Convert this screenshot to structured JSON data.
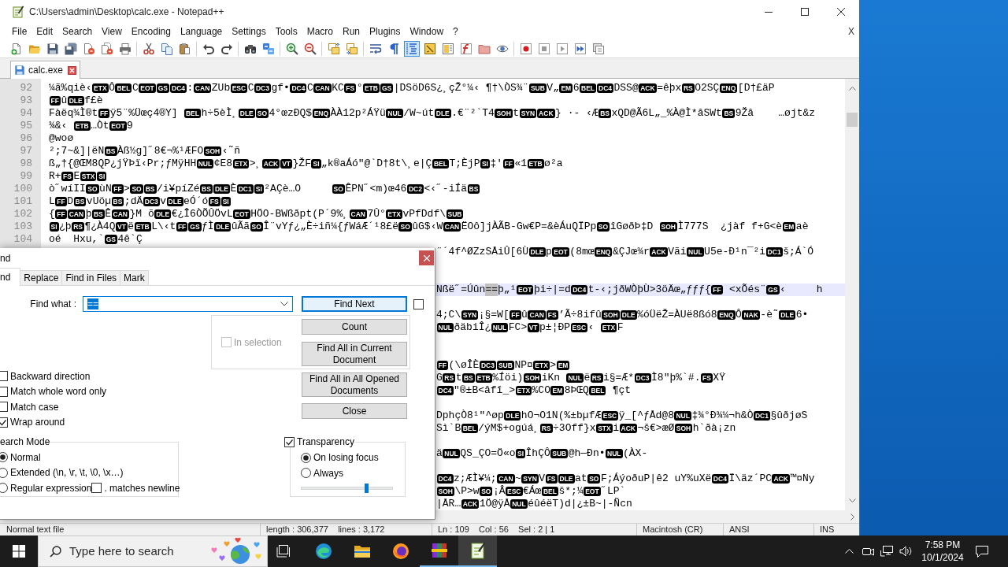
{
  "window": {
    "title": "C:\\Users\\admin\\Desktop\\calc.exe - Notepad++"
  },
  "menu": {
    "items": [
      "File",
      "Edit",
      "Search",
      "View",
      "Encoding",
      "Language",
      "Settings",
      "Tools",
      "Macro",
      "Run",
      "Plugins",
      "Window",
      "?"
    ],
    "close_document": "X"
  },
  "toolbar": [
    [
      {
        "pressed": false
      },
      {
        "pressed": false
      },
      {
        "pressed": false
      },
      {
        "pressed": false
      },
      {
        "pressed": false
      },
      {
        "pressed": false
      },
      {
        "pressed": false
      }
    ],
    [
      {
        "pressed": false
      },
      {
        "pressed": false
      },
      {
        "pressed": false
      }
    ],
    [
      {
        "pressed": false
      },
      {
        "pressed": false
      }
    ],
    [
      {
        "pressed": false
      },
      {
        "pressed": false
      }
    ],
    [
      {
        "pressed": false
      },
      {
        "pressed": false
      }
    ],
    [
      {
        "pressed": false
      },
      {
        "pressed": false
      }
    ],
    [
      {
        "pressed": false
      },
      {
        "pressed": false
      },
      {
        "pressed": true
      },
      {
        "pressed": false
      },
      {
        "pressed": false
      },
      {
        "pressed": false
      },
      {
        "pressed": false
      },
      {
        "pressed": false
      }
    ],
    [
      {
        "pressed": false
      },
      {
        "pressed": false
      },
      {
        "pressed": false
      },
      {
        "pressed": false
      },
      {
        "pressed": false
      }
    ]
  ],
  "tabs": [
    {
      "label": "calc.exe",
      "selected": true
    }
  ],
  "editor": {
    "lines": [
      {
        "number": "92",
        "current": false,
        "parts": [
          {
            "kind": "text",
            "text": "¼ã%qiè‹"
          },
          {
            "kind": "control",
            "text": "ETX"
          },
          {
            "kind": "text",
            "text": "Ô"
          },
          {
            "kind": "control",
            "text": "BEL"
          },
          {
            "kind": "text",
            "text": "C"
          },
          {
            "kind": "control",
            "text": "EOT"
          },
          {
            "kind": "control",
            "text": "GS"
          },
          {
            "kind": "control",
            "text": "DC4"
          },
          {
            "kind": "text",
            "text": ":"
          },
          {
            "kind": "control",
            "text": "CAN"
          },
          {
            "kind": "text",
            "text": "ZUb"
          },
          {
            "kind": "control",
            "text": "ESC"
          },
          {
            "kind": "text",
            "text": "C"
          },
          {
            "kind": "control",
            "text": "DC3"
          },
          {
            "kind": "text",
            "text": "gf•"
          },
          {
            "kind": "control",
            "text": "DC4"
          },
          {
            "kind": "text",
            "text": "C"
          },
          {
            "kind": "control",
            "text": "CAN"
          },
          {
            "kind": "text",
            "text": "KC"
          },
          {
            "kind": "control",
            "text": "FS"
          },
          {
            "kind": "text",
            "text": "°"
          },
          {
            "kind": "control",
            "text": "ETB"
          },
          {
            "kind": "control",
            "text": "GS"
          },
          {
            "kind": "text",
            "text": "|DSöD6S¿¸çŽ°¼‹ ¶†\\ÒS¾¨"
          },
          {
            "kind": "control",
            "text": "SUB"
          },
          {
            "kind": "text",
            "text": "V„"
          },
          {
            "kind": "control",
            "text": "EM"
          },
          {
            "kind": "text",
            "text": "6"
          },
          {
            "kind": "control",
            "text": "BEL"
          },
          {
            "kind": "control",
            "text": "DC4"
          },
          {
            "kind": "text",
            "text": "DSS@"
          },
          {
            "kind": "control",
            "text": "ACK"
          },
          {
            "kind": "text",
            "text": "=êþx"
          },
          {
            "kind": "control",
            "text": "RS"
          },
          {
            "kind": "text",
            "text": "O2SÇ"
          },
          {
            "kind": "control",
            "text": "ENQ"
          },
          {
            "kind": "text",
            "text": "[D†£äP"
          }
        ]
      },
      {
        "number": "93",
        "current": false,
        "parts": [
          {
            "kind": "control",
            "text": "FF"
          },
          {
            "kind": "text",
            "text": "û"
          },
          {
            "kind": "control",
            "text": "DLE"
          },
          {
            "kind": "text",
            "text": "f£è"
          }
        ]
      },
      {
        "number": "94",
        "current": false,
        "parts": [
          {
            "kind": "text",
            "text": "Fàëq¾Ì®t"
          },
          {
            "kind": "control",
            "text": "FF"
          },
          {
            "kind": "text",
            "text": "ÿ5¨%Üœç4®Y] "
          },
          {
            "kind": "control",
            "text": "BEL"
          },
          {
            "kind": "text",
            "text": "h÷5èÌ¸"
          },
          {
            "kind": "control",
            "text": "DLE"
          },
          {
            "kind": "control",
            "text": "SO"
          },
          {
            "kind": "text",
            "text": "4°œzÐQ$"
          },
          {
            "kind": "control",
            "text": "ENQ"
          },
          {
            "kind": "text",
            "text": "ÀÀ12p²ÁŸü"
          },
          {
            "kind": "control",
            "text": "NUL"
          },
          {
            "kind": "text",
            "text": "/W~út"
          },
          {
            "kind": "control",
            "text": "DLE"
          },
          {
            "kind": "text",
            "text": ".€¨²`T4"
          },
          {
            "kind": "control",
            "text": "SOH"
          },
          {
            "kind": "text",
            "text": "t"
          },
          {
            "kind": "control",
            "text": "SYN"
          },
          {
            "kind": "control",
            "text": "ACK"
          },
          {
            "kind": "text",
            "text": "} ·- ‹Æ"
          },
          {
            "kind": "control",
            "text": "BS"
          },
          {
            "kind": "text",
            "text": "xQD@Ã6L„_%À@Ì*âSWt"
          },
          {
            "kind": "control",
            "text": "BS"
          },
          {
            "kind": "text",
            "text": "9Žâ    …øjt&z"
          }
        ]
      },
      {
        "number": "95",
        "current": false,
        "parts": [
          {
            "kind": "text",
            "text": "¾&‹ "
          },
          {
            "kind": "control",
            "text": "ETB"
          },
          {
            "kind": "text",
            "text": "…Òt"
          },
          {
            "kind": "control",
            "text": "EOT"
          },
          {
            "kind": "text",
            "text": "9"
          }
        ]
      },
      {
        "number": "96",
        "current": false,
        "parts": [
          {
            "kind": "text",
            "text": "@woø"
          }
        ]
      },
      {
        "number": "97",
        "current": false,
        "parts": [
          {
            "kind": "text",
            "text": "²;7~&]|ëN"
          },
          {
            "kind": "control",
            "text": "BS"
          },
          {
            "kind": "text",
            "text": "Àß½g]˝8€¬%¹ÆFO"
          },
          {
            "kind": "control",
            "text": "SOH"
          },
          {
            "kind": "text",
            "text": "‹˜ñ"
          }
        ]
      },
      {
        "number": "98",
        "current": false,
        "parts": [
          {
            "kind": "text",
            "text": "ß„†{@ŒM8QP¿jŸÞï‹Pr;ƒMÿHH"
          },
          {
            "kind": "control",
            "text": "NUL"
          },
          {
            "kind": "text",
            "text": "¢E8"
          },
          {
            "kind": "control",
            "text": "ETX"
          },
          {
            "kind": "text",
            "text": ">¸"
          },
          {
            "kind": "control",
            "text": "ACK"
          },
          {
            "kind": "control",
            "text": "VT"
          },
          {
            "kind": "text",
            "text": "}ŽF"
          },
          {
            "kind": "control",
            "text": "SI"
          },
          {
            "kind": "text",
            "text": "„k®aÁó\"@`D†8t\\¸e|Ç"
          },
          {
            "kind": "control",
            "text": "BEL"
          },
          {
            "kind": "text",
            "text": "T;ÈjP"
          },
          {
            "kind": "control",
            "text": "SI"
          },
          {
            "kind": "text",
            "text": "‡'"
          },
          {
            "kind": "control",
            "text": "FF"
          },
          {
            "kind": "text",
            "text": "«1"
          },
          {
            "kind": "control",
            "text": "ETB"
          },
          {
            "kind": "text",
            "text": "ø²a"
          }
        ]
      },
      {
        "number": "99",
        "current": false,
        "parts": [
          {
            "kind": "text",
            "text": "R+"
          },
          {
            "kind": "control",
            "text": "FS"
          },
          {
            "kind": "text",
            "text": "E"
          },
          {
            "kind": "control",
            "text": "STX"
          },
          {
            "kind": "control",
            "text": "SI"
          }
        ]
      },
      {
        "number": "100",
        "current": false,
        "parts": [
          {
            "kind": "text",
            "text": "ò˝wíII"
          },
          {
            "kind": "control",
            "text": "SO"
          },
          {
            "kind": "text",
            "text": "ùN"
          },
          {
            "kind": "control",
            "text": "FF"
          },
          {
            "kind": "text",
            "text": ">"
          },
          {
            "kind": "control",
            "text": "SO"
          },
          {
            "kind": "control",
            "text": "BS"
          },
          {
            "kind": "text",
            "text": "/i¥píZé"
          },
          {
            "kind": "control",
            "text": "BS"
          },
          {
            "kind": "control",
            "text": "DLE"
          },
          {
            "kind": "text",
            "text": "È"
          },
          {
            "kind": "control",
            "text": "DC1"
          },
          {
            "kind": "control",
            "text": "SI"
          },
          {
            "kind": "text",
            "text": "²AÇè…O     "
          },
          {
            "kind": "control",
            "text": "SO"
          },
          {
            "kind": "text",
            "text": "ÊPN˝<m)œ46"
          },
          {
            "kind": "control",
            "text": "DC2"
          },
          {
            "kind": "text",
            "text": "<‹˝-iÍä"
          },
          {
            "kind": "control",
            "text": "BS"
          }
        ]
      },
      {
        "number": "101",
        "current": false,
        "parts": [
          {
            "kind": "text",
            "text": "L"
          },
          {
            "kind": "control",
            "text": "FF"
          },
          {
            "kind": "text",
            "text": "D"
          },
          {
            "kind": "control",
            "text": "BS"
          },
          {
            "kind": "text",
            "text": "vUöµ"
          },
          {
            "kind": "control",
            "text": "BS"
          },
          {
            "kind": "text",
            "text": ";dÄ"
          },
          {
            "kind": "control",
            "text": "DC3"
          },
          {
            "kind": "text",
            "text": "v"
          },
          {
            "kind": "control",
            "text": "DLE"
          },
          {
            "kind": "text",
            "text": "eÓ´ó"
          },
          {
            "kind": "control",
            "text": "FS"
          },
          {
            "kind": "control",
            "text": "SI"
          }
        ]
      },
      {
        "number": "102",
        "current": false,
        "parts": [
          {
            "kind": "text",
            "text": "{"
          },
          {
            "kind": "control",
            "text": "FF"
          },
          {
            "kind": "control",
            "text": "CAN"
          },
          {
            "kind": "text",
            "text": "þ"
          },
          {
            "kind": "control",
            "text": "BS"
          },
          {
            "kind": "text",
            "text": "Ê"
          },
          {
            "kind": "control",
            "text": "CAN"
          },
          {
            "kind": "text",
            "text": "}M õ"
          },
          {
            "kind": "control",
            "text": "DLE"
          },
          {
            "kind": "text",
            "text": "€¿Î6ÒÕÛÖvL"
          },
          {
            "kind": "control",
            "text": "EOT"
          },
          {
            "kind": "text",
            "text": "HÖO-BWßðpt(P´9%¸"
          },
          {
            "kind": "control",
            "text": "CAN"
          },
          {
            "kind": "text",
            "text": "7Û°"
          },
          {
            "kind": "control",
            "text": "ETX"
          },
          {
            "kind": "text",
            "text": "vPfDdf\\"
          },
          {
            "kind": "control",
            "text": "SUB"
          }
        ]
      },
      {
        "number": "103",
        "current": false,
        "parts": [
          {
            "kind": "control",
            "text": "SI"
          },
          {
            "kind": "text",
            "text": "¿þ"
          },
          {
            "kind": "control",
            "text": "RS"
          },
          {
            "kind": "text",
            "text": "¶¿À4Q"
          },
          {
            "kind": "control",
            "text": "VT"
          },
          {
            "kind": "text",
            "text": "ë"
          },
          {
            "kind": "control",
            "text": "ETB"
          },
          {
            "kind": "text",
            "text": "L\\‹t"
          },
          {
            "kind": "control",
            "text": "FF"
          },
          {
            "kind": "control",
            "text": "GS"
          },
          {
            "kind": "text",
            "text": "ƒÌ"
          },
          {
            "kind": "control",
            "text": "DLE"
          },
          {
            "kind": "text",
            "text": "ûÃã"
          },
          {
            "kind": "control",
            "text": "SO"
          },
          {
            "kind": "text",
            "text": "Î¨vYƒ¿„È÷iñ¼{ƒWáÆ´¹8£ë"
          },
          {
            "kind": "control",
            "text": "SO"
          },
          {
            "kind": "text",
            "text": "ûG$‹W"
          },
          {
            "kind": "control",
            "text": "CAN"
          },
          {
            "kind": "text",
            "text": "ËOô]jÀÃB-Gw€P=&èÁuQÏPp"
          },
          {
            "kind": "control",
            "text": "SO"
          },
          {
            "kind": "text",
            "text": "îGøðÞ‡D "
          },
          {
            "kind": "control",
            "text": "SOH"
          },
          {
            "kind": "text",
            "text": "Ì777S  ¿jàf f+G<è"
          },
          {
            "kind": "control",
            "text": "EM"
          },
          {
            "kind": "text",
            "text": "aè"
          }
        ]
      },
      {
        "number": "104",
        "current": false,
        "parts": [
          {
            "kind": "text",
            "text": "oé  Hxu,`"
          },
          {
            "kind": "control",
            "text": "GS"
          },
          {
            "kind": "text",
            "text": "4ê`Ç"
          }
        ]
      },
      {
        "current": false,
        "parts": [
          {
            "kind": "text",
            "text": "¨´4f^ØZzSÅiÛ[6Ù"
          },
          {
            "kind": "control",
            "text": "DLE"
          },
          {
            "kind": "text",
            "text": "p"
          },
          {
            "kind": "control",
            "text": "EOT"
          },
          {
            "kind": "text",
            "text": "(8mœ"
          },
          {
            "kind": "control",
            "text": "ENQ"
          },
          {
            "kind": "text",
            "text": "&ÇJœ¾r"
          },
          {
            "kind": "control",
            "text": "ACK"
          },
          {
            "kind": "text",
            "text": "Vãi"
          },
          {
            "kind": "control",
            "text": "NUL"
          },
          {
            "kind": "text",
            "text": "U5e-Ð¹n¯²i"
          },
          {
            "kind": "control",
            "text": "DC1"
          },
          {
            "kind": "text",
            "text": "š;Á`Ó"
          }
        ]
      },
      {
        "current": false
      },
      {
        "current": false
      },
      {
        "current": true,
        "parts": [
          {
            "kind": "text",
            "text": "Nßë˝=Úûn"
          },
          {
            "kind": "selection",
            "text": "=="
          },
          {
            "kind": "text",
            "text": "þ„¹"
          },
          {
            "kind": "control",
            "text": "EOT"
          },
          {
            "kind": "text",
            "text": "þi÷|=d"
          },
          {
            "kind": "control",
            "text": "DC4"
          },
          {
            "kind": "text",
            "text": "t-‹;jðWÒþÙ>3öÄœ„ƒƒƒ{"
          },
          {
            "kind": "control",
            "text": "FF"
          },
          {
            "kind": "text",
            "text": " <xÕés¨"
          },
          {
            "kind": "control",
            "text": "GS"
          },
          {
            "kind": "text",
            "text": "‹     h"
          }
        ]
      },
      {
        "current": false
      },
      {
        "current": false,
        "parts": [
          {
            "kind": "text",
            "text": "4;C\\"
          },
          {
            "kind": "control",
            "text": "SYN"
          },
          {
            "kind": "text",
            "text": "¡§=W["
          },
          {
            "kind": "control",
            "text": "FF"
          },
          {
            "kind": "text",
            "text": "û"
          },
          {
            "kind": "control",
            "text": "CAN"
          },
          {
            "kind": "control",
            "text": "FS"
          },
          {
            "kind": "text",
            "text": "’Ã÷8ifû"
          },
          {
            "kind": "control",
            "text": "SOH"
          },
          {
            "kind": "control",
            "text": "DLE"
          },
          {
            "kind": "text",
            "text": "%óÜëŽ=ÀUë8ßó8"
          },
          {
            "kind": "control",
            "text": "ENQ"
          },
          {
            "kind": "text",
            "text": "Ô"
          },
          {
            "kind": "control",
            "text": "NAK"
          },
          {
            "kind": "text",
            "text": "-è˜"
          },
          {
            "kind": "control",
            "text": "DLE"
          },
          {
            "kind": "text",
            "text": "6•"
          }
        ]
      },
      {
        "current": false,
        "parts": [
          {
            "kind": "control",
            "text": "NUL"
          },
          {
            "kind": "text",
            "text": "ðäbiÎ¿"
          },
          {
            "kind": "control",
            "text": "NUL"
          },
          {
            "kind": "text",
            "text": "FC>"
          },
          {
            "kind": "control",
            "text": "VT"
          },
          {
            "kind": "text",
            "text": "p±¦ÐP"
          },
          {
            "kind": "control",
            "text": "ESC"
          },
          {
            "kind": "text",
            "text": "‹ "
          },
          {
            "kind": "control",
            "text": "ETX"
          },
          {
            "kind": "text",
            "text": "F"
          }
        ]
      },
      {
        "current": false
      },
      {
        "current": false
      },
      {
        "current": false,
        "parts": [
          {
            "kind": "control",
            "text": "FF"
          },
          {
            "kind": "text",
            "text": "(\\øÎÈ"
          },
          {
            "kind": "control",
            "text": "DC3"
          },
          {
            "kind": "control",
            "text": "SUB"
          },
          {
            "kind": "text",
            "text": "NP¤"
          },
          {
            "kind": "control",
            "text": "ETX"
          },
          {
            "kind": "text",
            "text": ">"
          },
          {
            "kind": "control",
            "text": "EM"
          }
        ]
      },
      {
        "current": false,
        "parts": [
          {
            "kind": "text",
            "text": "G"
          },
          {
            "kind": "control",
            "text": "RS"
          },
          {
            "kind": "text",
            "text": "t"
          },
          {
            "kind": "control",
            "text": "BS"
          },
          {
            "kind": "control",
            "text": "ETB"
          },
          {
            "kind": "text",
            "text": "%Íöi)"
          },
          {
            "kind": "control",
            "text": "SOH"
          },
          {
            "kind": "text",
            "text": "iKn "
          },
          {
            "kind": "control",
            "text": "NUL"
          },
          {
            "kind": "text",
            "text": "ë"
          },
          {
            "kind": "control",
            "text": "RS"
          },
          {
            "kind": "text",
            "text": "i§=Æ*"
          },
          {
            "kind": "control",
            "text": "DC3"
          },
          {
            "kind": "text",
            "text": "Ì8\"þ%`#."
          },
          {
            "kind": "control",
            "text": "FS"
          },
          {
            "kind": "text",
            "text": "XŸ"
          }
        ]
      },
      {
        "current": false,
        "parts": [
          {
            "kind": "control",
            "text": "DC4"
          },
          {
            "kind": "text",
            "text": "\"®±B<âfî_>"
          },
          {
            "kind": "control",
            "text": "ETX"
          },
          {
            "kind": "text",
            "text": "%CO"
          },
          {
            "kind": "control",
            "text": "EM"
          },
          {
            "kind": "text",
            "text": "8ÞŒQ"
          },
          {
            "kind": "control",
            "text": "BEL"
          },
          {
            "kind": "text",
            "text": " ¶çt"
          }
        ]
      },
      {
        "current": false
      },
      {
        "current": false,
        "parts": [
          {
            "kind": "text",
            "text": "DphçÒ8¹\"^øp"
          },
          {
            "kind": "control",
            "text": "DLE"
          },
          {
            "kind": "text",
            "text": "hO¬O1N(%±bµfÆ"
          },
          {
            "kind": "control",
            "text": "ESC"
          },
          {
            "kind": "text",
            "text": "ÿ_[^ƒÅd@8"
          },
          {
            "kind": "control",
            "text": "NUL"
          },
          {
            "kind": "text",
            "text": "‡¾°Ð¾¼¬h&Ò"
          },
          {
            "kind": "control",
            "text": "DC1"
          },
          {
            "kind": "text",
            "text": "§ûðjøS"
          }
        ]
      },
      {
        "current": false,
        "parts": [
          {
            "kind": "text",
            "text": "Sì`B"
          },
          {
            "kind": "control",
            "text": "BEL"
          },
          {
            "kind": "text",
            "text": "/ýM$+ogúá¸"
          },
          {
            "kind": "control",
            "text": "RS"
          },
          {
            "kind": "text",
            "text": "÷3Off}x"
          },
          {
            "kind": "control",
            "text": "STX"
          },
          {
            "kind": "text",
            "text": "i"
          },
          {
            "kind": "control",
            "text": "ACK"
          },
          {
            "kind": "text",
            "text": "¬š€>æØ"
          },
          {
            "kind": "control",
            "text": "SOH"
          },
          {
            "kind": "text",
            "text": "h`ðà¡zn"
          }
        ]
      },
      {
        "current": false
      },
      {
        "current": false,
        "parts": [
          {
            "kind": "text",
            "text": "ä"
          },
          {
            "kind": "control",
            "text": "NUL"
          },
          {
            "kind": "text",
            "text": "QS_ÇO=Ö«o"
          },
          {
            "kind": "control",
            "text": "SI"
          },
          {
            "kind": "text",
            "text": "ÎhÇÔ"
          },
          {
            "kind": "control",
            "text": "SUB"
          },
          {
            "kind": "text",
            "text": "@h—Ðn•"
          },
          {
            "kind": "control",
            "text": "NUL"
          },
          {
            "kind": "text",
            "text": "(ÀX-"
          }
        ]
      },
      {
        "current": false
      },
      {
        "current": false,
        "parts": [
          {
            "kind": "control",
            "text": "DC4"
          },
          {
            "kind": "text",
            "text": "z;ÆÌ¥¼;"
          },
          {
            "kind": "control",
            "text": "CAN"
          },
          {
            "kind": "text",
            "text": "~"
          },
          {
            "kind": "control",
            "text": "SYN"
          },
          {
            "kind": "text",
            "text": "V"
          },
          {
            "kind": "control",
            "text": "FS"
          },
          {
            "kind": "control",
            "text": "DLE"
          },
          {
            "kind": "text",
            "text": "at"
          },
          {
            "kind": "control",
            "text": "SO"
          },
          {
            "kind": "text",
            "text": "F;ÁýoðuP|ê2 uY%uXë"
          },
          {
            "kind": "control",
            "text": "DC4"
          },
          {
            "kind": "text",
            "text": "Ï\\äz´PC"
          },
          {
            "kind": "control",
            "text": "ACK"
          },
          {
            "kind": "text",
            "text": "™¤Ny"
          }
        ]
      },
      {
        "current": false,
        "parts": [
          {
            "kind": "control",
            "text": "SOH"
          },
          {
            "kind": "text",
            "text": "\\P>w"
          },
          {
            "kind": "control",
            "text": "SO"
          },
          {
            "kind": "text",
            "text": "¡Â"
          },
          {
            "kind": "control",
            "text": "ESC"
          },
          {
            "kind": "text",
            "text": "€Áœ"
          },
          {
            "kind": "control",
            "text": "BEL"
          },
          {
            "kind": "text",
            "text": "š*;¼"
          },
          {
            "kind": "control",
            "text": "EOT"
          },
          {
            "kind": "text",
            "text": "˝LP`"
          }
        ]
      },
      {
        "current": false,
        "parts": [
          {
            "kind": "text",
            "text": "|ÅR…"
          },
          {
            "kind": "control",
            "text": "ACK"
          },
          {
            "kind": "text",
            "text": "1Ö@ÿÅ"
          },
          {
            "kind": "control",
            "text": "NUL"
          },
          {
            "kind": "text",
            "text": "éûéëT)d|¿±B~|-Ñcn"
          }
        ]
      }
    ]
  },
  "status_bar": {
    "sections": [
      "Normal text file",
      "length : 306,377    lines : 3,172",
      "Ln : 109    Col : 56    Sel : 2 | 1",
      "Macintosh (CR)",
      "ANSI",
      "INS"
    ]
  },
  "find_dialog": {
    "title": "nd",
    "tabs": [
      {
        "label": "nd",
        "selected": true
      },
      {
        "label": "Replace",
        "selected": false
      },
      {
        "label": "Find in Files",
        "selected": false
      },
      {
        "label": "Mark",
        "selected": false
      }
    ],
    "find_what": {
      "label": "Find what :",
      "value": "==",
      "selected": true
    },
    "find_next": {
      "label": "Find Next",
      "default": true
    },
    "two_buttons_mode": {
      "checked": false
    },
    "in_selection": {
      "label": "In selection",
      "checked": false,
      "disabled": true
    },
    "selection_buttons": [
      "Count",
      "Find All in Current Document"
    ],
    "buttons": [
      "Find All in All Opened Documents",
      "Close"
    ],
    "options": [
      {
        "label": "Backward direction",
        "checked": false
      },
      {
        "label": "Match whole word only",
        "checked": false
      },
      {
        "label": "Match case",
        "checked": false
      },
      {
        "label": "Wrap around",
        "checked": true
      }
    ],
    "search_mode": {
      "title": "earch Mode",
      "modes": [
        {
          "label": "Normal",
          "selected": true
        },
        {
          "label": "Extended (\\n, \\r, \\t, \\0, \\x…)",
          "selected": false
        },
        {
          "label": "Regular expression",
          "selected": false
        }
      ],
      "matches_newline": {
        "label": ". matches newline",
        "checked": false
      }
    },
    "transparency": {
      "label": "Transparency",
      "checked": true,
      "modes": [
        {
          "label": "On losing focus",
          "selected": true
        },
        {
          "label": "Always",
          "selected": false
        }
      ],
      "level": 0.71
    }
  },
  "taskbar": {
    "search": {
      "placeholder": "Type here to search"
    },
    "apps": [
      {
        "running": false,
        "active": false
      },
      {
        "running": false,
        "active": false
      },
      {
        "running": false,
        "active": false
      },
      {
        "running": true,
        "active": false
      },
      {
        "running": true,
        "active": true
      }
    ],
    "clock": {
      "time": "7:58 PM",
      "date": "10/1/2024"
    }
  }
}
